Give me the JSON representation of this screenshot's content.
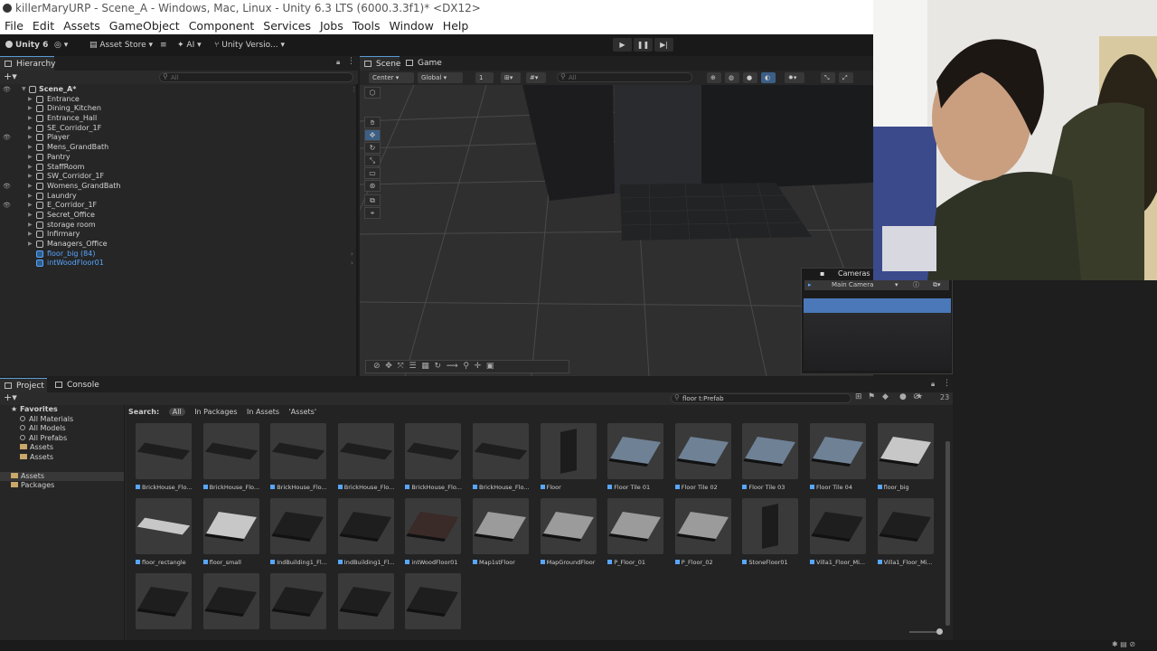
{
  "title": "killerMaryURP - Scene_A - Windows, Mac, Linux - Unity 6.3 LTS (6000.3.3f1)* <DX12>",
  "menu": [
    "File",
    "Edit",
    "Assets",
    "GameObject",
    "Component",
    "Services",
    "Jobs",
    "Tools",
    "Window",
    "Help"
  ],
  "toolbar": {
    "account": "Unity 6",
    "asset_store": "Asset Store",
    "ai": "AI",
    "version_control": "Unity Versio..."
  },
  "hierarchy": {
    "tab": "Hierarchy",
    "search_placeholder": "All",
    "scene": "Scene_A*",
    "items": [
      {
        "label": "Entrance",
        "prefab": false
      },
      {
        "label": "Dining_Kitchen",
        "prefab": false
      },
      {
        "label": "Entrance_Hall",
        "prefab": false
      },
      {
        "label": "SE_Corridor_1F",
        "prefab": false
      },
      {
        "label": "Player",
        "prefab": false
      },
      {
        "label": "Mens_GrandBath",
        "prefab": false
      },
      {
        "label": "Pantry",
        "prefab": false
      },
      {
        "label": "StaffRoom",
        "prefab": false
      },
      {
        "label": "SW_Corridor_1F",
        "prefab": false
      },
      {
        "label": "Womens_GrandBath",
        "prefab": false
      },
      {
        "label": "Laundry",
        "prefab": false
      },
      {
        "label": "E_Corridor_1F",
        "prefab": false
      },
      {
        "label": "Secret_Office",
        "prefab": false
      },
      {
        "label": "storage room",
        "prefab": false
      },
      {
        "label": "Infirmary",
        "prefab": false
      },
      {
        "label": "Managers_Office",
        "prefab": false
      },
      {
        "label": "floor_big (84)",
        "prefab": true
      },
      {
        "label": "intWoodFloor01",
        "prefab": true
      }
    ]
  },
  "scene": {
    "tabs": [
      "Scene",
      "Game"
    ],
    "pivot": "Center",
    "space": "Global",
    "grid_snap": "1",
    "search_placeholder": "All"
  },
  "cameras": {
    "title": "Cameras",
    "selected": "Main Camera"
  },
  "project": {
    "tabs": [
      "Project",
      "Console"
    ],
    "search_text": "floor t:Prefab",
    "count": "23",
    "favorites_title": "Favorites",
    "favorites": [
      "All Materials",
      "All Models",
      "All Prefabs",
      "Assets",
      "Assets"
    ],
    "roots": [
      "Assets",
      "Packages"
    ],
    "search_label": "Search:",
    "filters": [
      "All",
      "In Packages",
      "In Assets",
      "'Assets'"
    ],
    "assets": [
      "BrickHouse_Flo...",
      "BrickHouse_Flo...",
      "BrickHouse_Flo...",
      "BrickHouse_Flo...",
      "BrickHouse_Flo...",
      "BrickHouse_Flo...",
      "Floor",
      "Floor Tile 01",
      "Floor Tile 02",
      "Floor Tile 03",
      "Floor Tile 04",
      "floor_big",
      "floor_rectangle",
      "floor_small",
      "IndBuilding1_Fl...",
      "IndBuilding1_Fl...",
      "intWoodFloor01",
      "Map1stFloor",
      "MapGroundFloor",
      "P_Floor_01",
      "P_Floor_02",
      "StoneFloor01",
      "Villa1_Floor_Mi...",
      "Villa1_Floor_Mi...",
      "",
      "",
      "",
      "",
      ""
    ]
  },
  "colors": {
    "accent": "#58a6ff",
    "panel": "#262626",
    "toolbar": "#191919",
    "selection": "#3c5f86"
  }
}
